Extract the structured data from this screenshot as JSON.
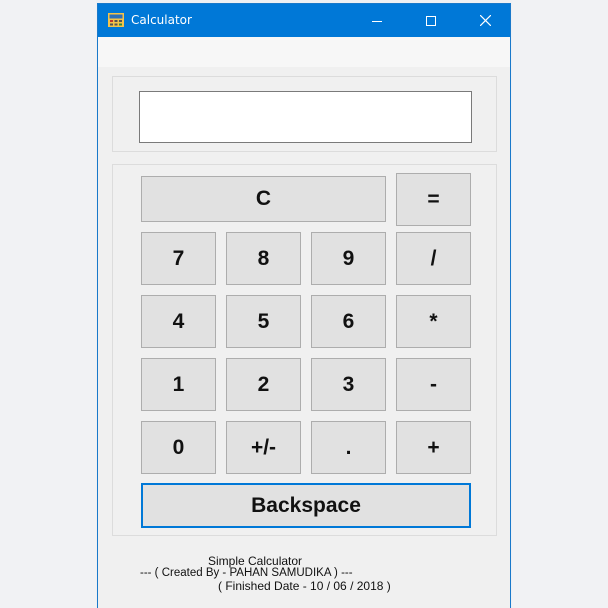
{
  "window": {
    "title": "Calculator",
    "icon": "calculator-app-icon",
    "controls": [
      "minimize-icon",
      "maximize-icon",
      "close-icon"
    ],
    "titlebar_color": "#0078d7"
  },
  "display": {
    "value": ""
  },
  "keys": {
    "clear": "C",
    "equals": "=",
    "seven": "7",
    "eight": "8",
    "nine": "9",
    "divide": "/",
    "four": "4",
    "five": "5",
    "six": "6",
    "multiply": "*",
    "one": "1",
    "two": "2",
    "three": "3",
    "subtract": "-",
    "zero": "0",
    "negate": "+/-",
    "decimal": ".",
    "add": "+",
    "backspace": "Backspace"
  },
  "footer": {
    "line1": "Simple Calculator",
    "line2": "--- ( Created By - PAHAN SAMUDIKA ) ---",
    "line3": "( Finished Date - 10 / 06 / 2018 )"
  }
}
